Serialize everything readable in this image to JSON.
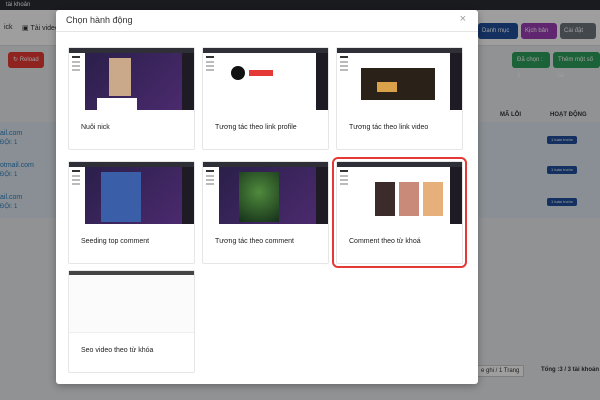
{
  "background": {
    "app_title": "tài khoản",
    "toolbar": {
      "nick_label": "ick",
      "upload_label": "Tải video",
      "danh_muc": "Danh mục",
      "kich_ban": "Kịch bản",
      "cai_dat": "Cài đặt"
    },
    "reload_label": "Reload",
    "selected_count": "Đã chọn : 3",
    "add_account": "Thêm một số tài",
    "columns": {
      "errors": "MÃ LỖI",
      "activity": "HOẠT ĐỘNG"
    },
    "rows": [
      {
        "email": "ail.com",
        "sub": "ĐỘI: 1",
        "badge": "1 tuần trước"
      },
      {
        "email": "otmail.com",
        "sub": "ĐỘI: 1",
        "badge": "1 tuần trước"
      },
      {
        "email": "ail.com",
        "sub": "ĐỘI: 1",
        "badge": "1 tuần trước"
      }
    ],
    "page_size": "e ghi / 1 Trang",
    "total": "Tổng :3 / 3 tài khoản"
  },
  "modal": {
    "title": "Chọn hành động",
    "close": "×",
    "actions": [
      {
        "label": "Nuôi nick",
        "thumb": "video-feed"
      },
      {
        "label": "Tương tác theo link profile",
        "thumb": "profile"
      },
      {
        "label": "Tương tác theo link video",
        "thumb": "video-page"
      },
      {
        "label": "Seeding top comment",
        "thumb": "video-feed"
      },
      {
        "label": "Tương tác theo comment",
        "thumb": "forest-video"
      },
      {
        "label": "Comment theo từ khoá",
        "thumb": "search-results"
      },
      {
        "label": "Seo video theo từ khóa",
        "thumb": "blank"
      }
    ],
    "selected_index": 5
  },
  "colors": {
    "selection": "#e53935",
    "accent_blue": "#1f4e9c",
    "green": "#2e9e5b",
    "red": "#e53935"
  }
}
